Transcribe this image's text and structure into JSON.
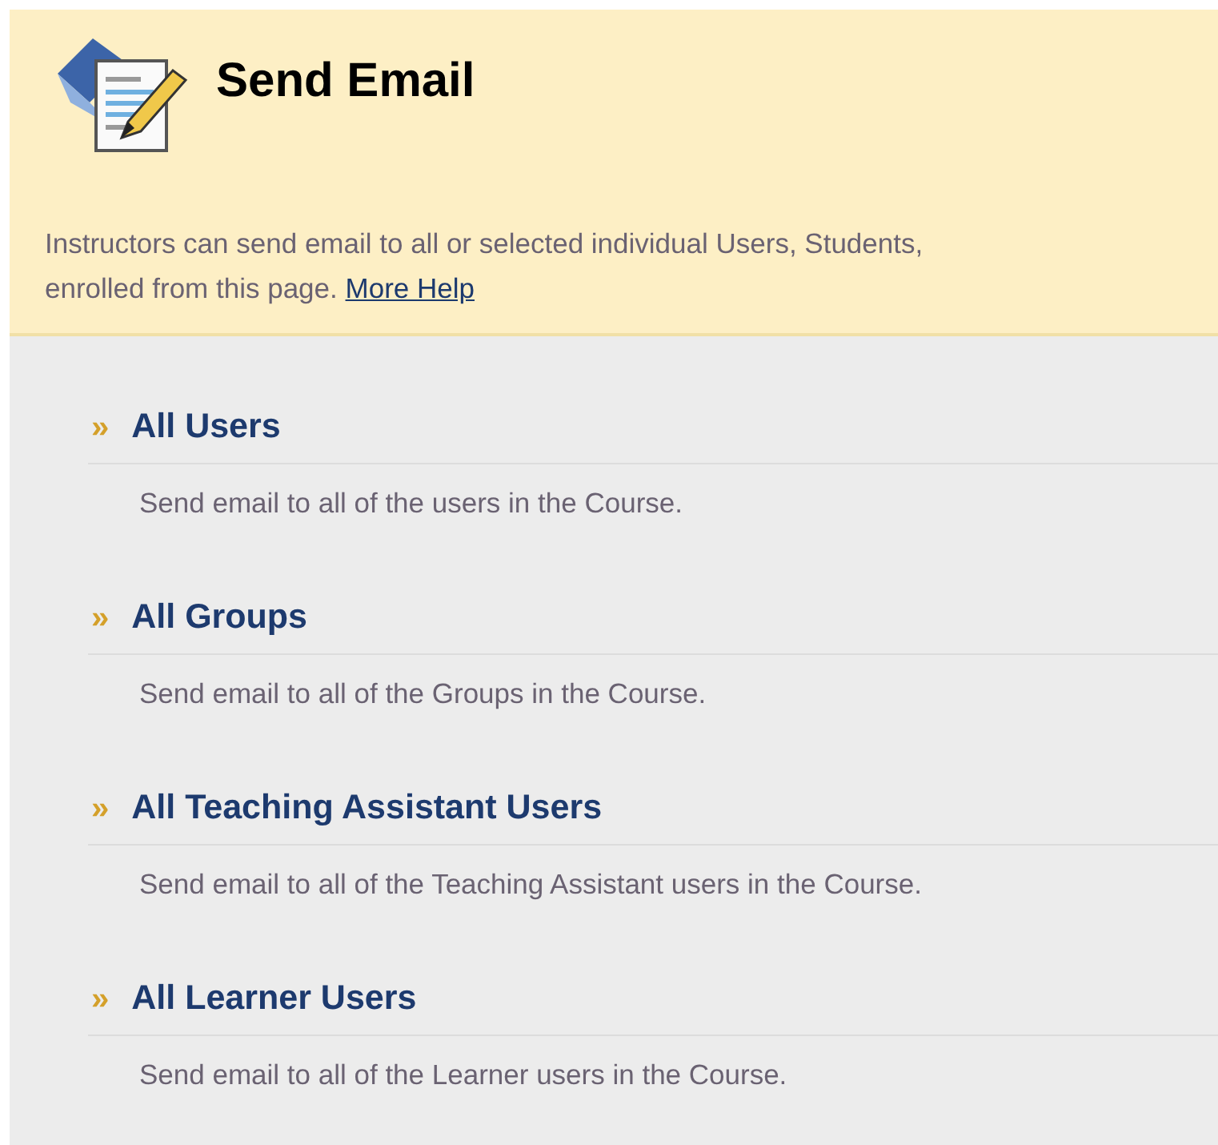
{
  "header": {
    "title": "Send Email",
    "intro_lines": [
      "Instructors can send email to all or selected individual Users, Students,",
      "enrolled from this page."
    ],
    "help_link": "More Help"
  },
  "options": [
    {
      "marker": "»",
      "title": "All Users",
      "description": "Send email to all of the users in the Course."
    },
    {
      "marker": "»",
      "title": "All Groups",
      "description": "Send email to all of the Groups in the Course."
    },
    {
      "marker": "»",
      "title": "All Teaching Assistant Users",
      "description": "Send email to all of the Teaching Assistant users in the Course."
    },
    {
      "marker": "»",
      "title": "All Learner Users",
      "description": "Send email to all of the Learner users in the Course."
    }
  ]
}
